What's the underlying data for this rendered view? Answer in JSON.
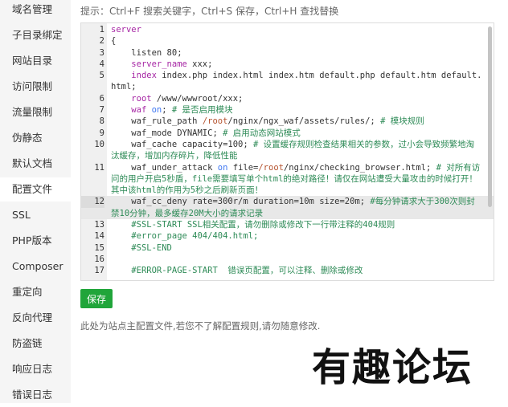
{
  "sidebar": {
    "items": [
      {
        "label": "域名管理"
      },
      {
        "label": "子目录绑定"
      },
      {
        "label": "网站目录"
      },
      {
        "label": "访问限制"
      },
      {
        "label": "流量限制"
      },
      {
        "label": "伪静态"
      },
      {
        "label": "默认文档"
      },
      {
        "label": "配置文件",
        "active": true
      },
      {
        "label": "SSL"
      },
      {
        "label": "PHP版本"
      },
      {
        "label": "Composer"
      },
      {
        "label": "重定向"
      },
      {
        "label": "反向代理"
      },
      {
        "label": "防盗链"
      },
      {
        "label": "响应日志"
      },
      {
        "label": "错误日志"
      }
    ]
  },
  "hint": "提示：Ctrl+F 搜索关键字，Ctrl+S 保存，Ctrl+H 查找替换",
  "editor": {
    "colors": {
      "keyword": "#a626a4",
      "on": "#4078f2",
      "path": "#b5532f",
      "comment": "#2e8b57",
      "text": "#333333"
    },
    "lines": [
      {
        "n": "1",
        "segs": [
          {
            "t": "server",
            "c": "keyword"
          }
        ]
      },
      {
        "n": "2",
        "segs": [
          {
            "t": "{",
            "c": "text"
          }
        ]
      },
      {
        "n": "3",
        "segs": [
          {
            "t": "    listen 80;",
            "c": "text"
          }
        ]
      },
      {
        "n": "4",
        "segs": [
          {
            "t": "    ",
            "c": "text"
          },
          {
            "t": "server_name",
            "c": "keyword"
          },
          {
            "t": " xxx;",
            "c": "text"
          }
        ]
      },
      {
        "n": "5",
        "segs": [
          {
            "t": "    ",
            "c": "text"
          },
          {
            "t": "index",
            "c": "keyword"
          },
          {
            "t": " index.php index.html index.htm default.php default.htm default.html;",
            "c": "text"
          }
        ]
      },
      {
        "n": "6",
        "segs": [
          {
            "t": "    ",
            "c": "text"
          },
          {
            "t": "root",
            "c": "keyword"
          },
          {
            "t": " /www/wwwroot/xxx;",
            "c": "text"
          }
        ]
      },
      {
        "n": "7",
        "segs": [
          {
            "t": "    ",
            "c": "text"
          },
          {
            "t": "waf",
            "c": "keyword"
          },
          {
            "t": " ",
            "c": "text"
          },
          {
            "t": "on",
            "c": "on"
          },
          {
            "t": "; ",
            "c": "text"
          },
          {
            "t": "# 是否启用模块",
            "c": "comment"
          }
        ]
      },
      {
        "n": "8",
        "segs": [
          {
            "t": "    waf_rule_path ",
            "c": "text"
          },
          {
            "t": "/root",
            "c": "path"
          },
          {
            "t": "/nginx/ngx_waf/assets/rules/; ",
            "c": "text"
          },
          {
            "t": "# 模块规则",
            "c": "comment"
          }
        ]
      },
      {
        "n": "9",
        "segs": [
          {
            "t": "    waf_mode DYNAMIC; ",
            "c": "text"
          },
          {
            "t": "# 启用动态网站模式",
            "c": "comment"
          }
        ]
      },
      {
        "n": "10",
        "segs": [
          {
            "t": "    waf_cache capacity=100; ",
            "c": "text"
          },
          {
            "t": "# 设置缓存规则检查结果相关的参数，过小会导致频繁地淘汰缓存，增加内存碎片，降低性能",
            "c": "comment"
          }
        ]
      },
      {
        "n": "11",
        "segs": [
          {
            "t": "    waf_under_attack ",
            "c": "text"
          },
          {
            "t": "on",
            "c": "on"
          },
          {
            "t": " file=",
            "c": "text"
          },
          {
            "t": "/root",
            "c": "path"
          },
          {
            "t": "/nginx/checking_browser.html; ",
            "c": "text"
          },
          {
            "t": "# 对所有访问的用户开启5秒盾，file需要填写单个html的绝对路径！请仅在网站遭受大量攻击的时候打开！其中该html的作用为5秒之后刷新页面！",
            "c": "comment"
          }
        ]
      },
      {
        "n": "12",
        "active": true,
        "segs": [
          {
            "t": "    waf_cc_deny rate=300r/m duration=10m size=20m; ",
            "c": "text"
          },
          {
            "t": "#每分钟请求大于300次则封禁10分钟，最多缓存20M大小的请求记录",
            "c": "comment"
          }
        ]
      },
      {
        "n": "13",
        "segs": [
          {
            "t": "    ",
            "c": "text"
          },
          {
            "t": "#SSL-START SSL相关配置，请勿删除或修改下一行带注释的404规则",
            "c": "comment"
          }
        ]
      },
      {
        "n": "14",
        "segs": [
          {
            "t": "    ",
            "c": "text"
          },
          {
            "t": "#error_page 404/404.html;",
            "c": "comment"
          }
        ]
      },
      {
        "n": "15",
        "segs": [
          {
            "t": "    ",
            "c": "text"
          },
          {
            "t": "#SSL-END",
            "c": "comment"
          }
        ]
      },
      {
        "n": "16",
        "segs": [
          {
            "t": " ",
            "c": "text"
          }
        ]
      },
      {
        "n": "17",
        "segs": [
          {
            "t": "    ",
            "c": "text"
          },
          {
            "t": "#ERROR-PAGE-START  错误页配置，可以注释、删除或修改",
            "c": "comment"
          }
        ]
      }
    ]
  },
  "save_label": "保存",
  "note": "此处为站点主配置文件,若您不了解配置规则,请勿随意修改.",
  "watermark": "有趣论坛"
}
